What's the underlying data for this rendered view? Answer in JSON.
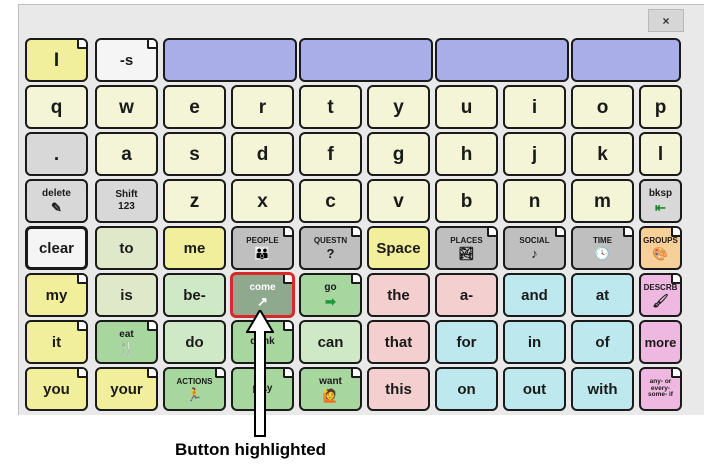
{
  "window": {
    "close_label": "×"
  },
  "rows": [
    [
      {
        "label": "I",
        "pic": ""
      },
      {
        "label": "-s",
        "pic": ""
      },
      {
        "label": "",
        "pic": ""
      },
      {
        "label": "",
        "pic": ""
      },
      {
        "label": "",
        "pic": ""
      },
      {
        "label": "",
        "pic": ""
      }
    ],
    [
      {
        "label": "q"
      },
      {
        "label": "w"
      },
      {
        "label": "e"
      },
      {
        "label": "r"
      },
      {
        "label": "t"
      },
      {
        "label": "y"
      },
      {
        "label": "u"
      },
      {
        "label": "i"
      },
      {
        "label": "o"
      },
      {
        "label": "p"
      }
    ],
    [
      {
        "label": "."
      },
      {
        "label": "a"
      },
      {
        "label": "s"
      },
      {
        "label": "d"
      },
      {
        "label": "f"
      },
      {
        "label": "g"
      },
      {
        "label": "h"
      },
      {
        "label": "j"
      },
      {
        "label": "k"
      },
      {
        "label": "l"
      }
    ],
    [
      {
        "label": "delete",
        "pic": "✎"
      },
      {
        "label": "Shift",
        "sub": "123"
      },
      {
        "label": "z"
      },
      {
        "label": "x"
      },
      {
        "label": "c"
      },
      {
        "label": "v"
      },
      {
        "label": "b"
      },
      {
        "label": "n"
      },
      {
        "label": "m"
      },
      {
        "label": "bksp",
        "pic": "⇤"
      }
    ],
    [
      {
        "label": "clear"
      },
      {
        "label": "to"
      },
      {
        "label": "me"
      },
      {
        "label": "PEOPLE",
        "pic": "👪"
      },
      {
        "label": "QUESTN",
        "pic": "?"
      },
      {
        "label": "Space"
      },
      {
        "label": "PLACES",
        "pic": "🏞"
      },
      {
        "label": "SOCIAL",
        "pic": "♪"
      },
      {
        "label": "TIME",
        "pic": "🕓"
      },
      {
        "label": "GROUPS",
        "pic": "🎨"
      }
    ],
    [
      {
        "label": "my"
      },
      {
        "label": "is"
      },
      {
        "label": "be-"
      },
      {
        "label": "come",
        "pic": "↗"
      },
      {
        "label": "go",
        "pic": "➡"
      },
      {
        "label": "the"
      },
      {
        "label": "a-"
      },
      {
        "label": "and"
      },
      {
        "label": "at"
      },
      {
        "label": "DESCRB",
        "pic": "🖌"
      }
    ],
    [
      {
        "label": "it"
      },
      {
        "label": "eat",
        "pic": "🍴"
      },
      {
        "label": "do"
      },
      {
        "label": "drink",
        "pic": ""
      },
      {
        "label": "can"
      },
      {
        "label": "that"
      },
      {
        "label": "for"
      },
      {
        "label": "in"
      },
      {
        "label": "of"
      },
      {
        "label": "more"
      }
    ],
    [
      {
        "label": "you"
      },
      {
        "label": "your"
      },
      {
        "label": "ACTIONS",
        "pic": "🏃"
      },
      {
        "label": "play",
        "pic": ""
      },
      {
        "label": "want",
        "pic": "🙋"
      },
      {
        "label": "this"
      },
      {
        "label": "on"
      },
      {
        "label": "out"
      },
      {
        "label": "with"
      },
      {
        "label": "any- or every- some- if"
      }
    ]
  ],
  "annotation": {
    "caption": "Button highlighted"
  }
}
